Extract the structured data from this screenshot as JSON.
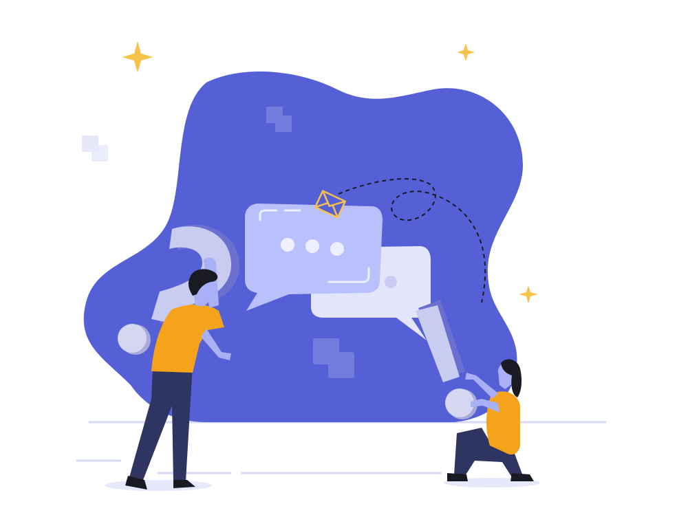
{
  "illustration": {
    "theme": "communication",
    "elements": [
      "chat-bubbles",
      "question-mark",
      "exclamation-mark",
      "envelope",
      "sparkles",
      "two-people"
    ]
  },
  "colors": {
    "background": "#ffffff",
    "blob": "#5560d6",
    "bubble_front": "#b9c0fb",
    "bubble_back": "#e3e6fb",
    "accent_yellow": "#f7c24a",
    "shirt": "#f5a31b",
    "pants": "#2f3561",
    "skin": "#a9b0f5",
    "hair": "#1a1a22",
    "ground_line": "#d6d9f7"
  }
}
